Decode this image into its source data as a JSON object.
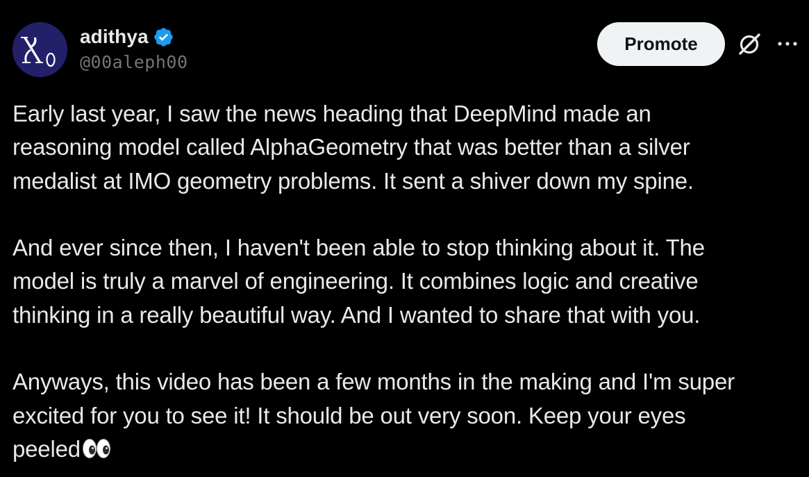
{
  "author": {
    "display_name": "adithya",
    "handle": "@00aleph00",
    "avatar_text": "ℵ₀",
    "verified": true
  },
  "actions": {
    "promote_label": "Promote",
    "grok_icon": "grok-icon",
    "more_icon": "more-icon"
  },
  "post": {
    "paragraphs": [
      "Early last year, I saw the news heading that DeepMind made an\nreasoning model called AlphaGeometry that was better than a silver\nmedalist at IMO geometry problems. It sent a shiver down my spine.",
      "And ever since then, I haven't been able to stop thinking about it. The\nmodel is truly a marvel of engineering. It combines logic and creative\nthinking in a really beautiful way. And I wanted to share that with you.",
      "Anyways, this video has been a few months in the making and I'm super\nexcited for you to see it! It should be out very soon. Keep your eyes\npeeled"
    ],
    "trailing_emoji": "👀"
  },
  "colors": {
    "background": "#000000",
    "text_primary": "#e7e9ea",
    "text_secondary": "#71767b",
    "verified_blue": "#1d9bf0",
    "button_bg": "#eff3f4",
    "button_text": "#0f1419",
    "avatar_bg": "#23206a"
  }
}
